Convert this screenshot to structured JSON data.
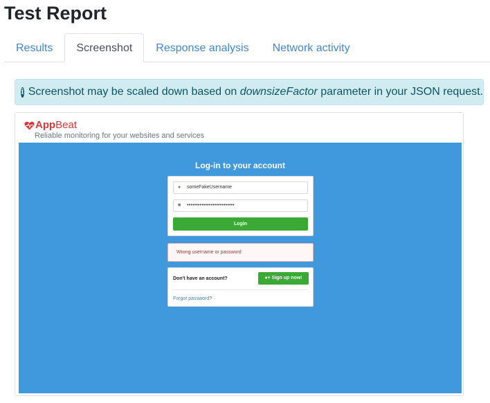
{
  "page": {
    "title": "Test Report"
  },
  "tabs": [
    {
      "label": "Results",
      "active": false
    },
    {
      "label": "Screenshot",
      "active": true
    },
    {
      "label": "Response analysis",
      "active": false
    },
    {
      "label": "Network activity",
      "active": false
    }
  ],
  "alert": {
    "icon": "info-icon",
    "text_before": "Screenshot may be scaled down based on ",
    "emphasis": "downsizeFactor",
    "text_after": " parameter in your JSON request."
  },
  "screenshot": {
    "brand": {
      "app": "App",
      "beat": "Beat",
      "icon": "heart-icon"
    },
    "tagline": "Reliable monitoring for your websites and services",
    "login": {
      "heading": "Log-in to your account",
      "username_value": "someFakeUsername",
      "password_value": "••••••••••••••••••••••••••",
      "button_label": "Login"
    },
    "error": "Wrong username or password",
    "signup": {
      "prompt": "Don't have an account?",
      "button_label": "Sign up now!",
      "forgot_label": "Forgot password?"
    }
  },
  "colors": {
    "accent_link": "#3f87d6",
    "alert_bg": "#d1ecf1",
    "screenshot_bg": "#4099dc",
    "button_green": "#3ba935",
    "brand_red": "#d9383a"
  }
}
